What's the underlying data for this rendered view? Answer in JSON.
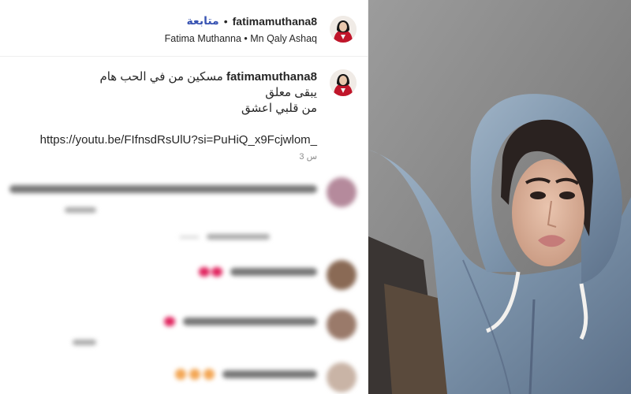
{
  "header": {
    "follow_label": "متابعة",
    "separator": "•",
    "username": "fatimamuthana8",
    "subline": "Fatima Muthanna • Mn Qaly Ashaq"
  },
  "caption": {
    "username": "fatimamuthana8",
    "line1": " مسكين من في الحب هام",
    "line2": "يبقى معلق",
    "line3": "من قلبي اعشق",
    "link": "https://youtu.be/FIfnsdRsUlU?si=PuHiQ_x9Fcjwlom_",
    "time": "3 س"
  },
  "comments_note": "",
  "colors": {
    "follow": "#3a55b3",
    "text": "#262626",
    "muted": "#8e8e8e",
    "heart": "#e0245e"
  },
  "icons": {
    "avatar": "profile-avatar-icon",
    "heart": "heart-icon"
  }
}
